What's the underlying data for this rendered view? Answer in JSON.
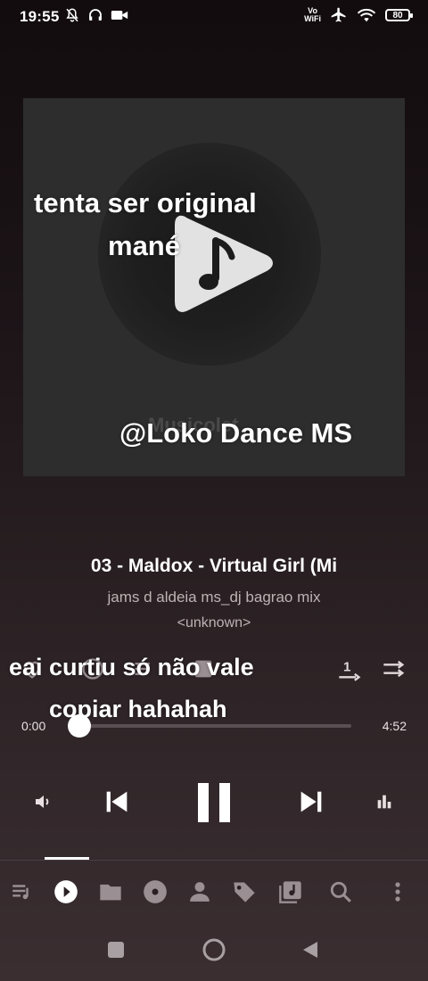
{
  "status_bar": {
    "time": "19:55",
    "volte_line1": "Vo",
    "volte_line2": "WiFi",
    "battery": "80"
  },
  "album": {
    "watermark_text": "Musicolet"
  },
  "overlays": {
    "line1": "tenta ser original",
    "line2": "mané",
    "line3": "@Loko Dance MS",
    "line4": "eai curtiu só não vale",
    "line5": "copiar hahahah"
  },
  "track": {
    "title": "03 - Maldox - Virtual Girl (Mi",
    "artist": "jams d aldeia ms_dj bagrao mix",
    "album": "<unknown>"
  },
  "playback": {
    "current_time": "0:00",
    "total_time": "4:52",
    "progress": 0.0,
    "state": "playing"
  },
  "colors": {
    "accent": "#ffffff",
    "muted_text": "#bdb2b4",
    "album_bg": "#2d2d2d"
  },
  "icons": {
    "actions": [
      "heart-icon",
      "info-icon",
      "queue-add-icon",
      "edit-icon",
      "repeat-one-icon",
      "shuffle-icon"
    ],
    "controls": [
      "volume-icon",
      "previous-icon",
      "pause-icon",
      "next-icon",
      "equalizer-icon"
    ],
    "tabs": [
      "queue-icon",
      "now-playing-icon",
      "folder-icon",
      "album-icon",
      "artist-icon",
      "tag-icon",
      "playlist-icon",
      "search-icon",
      "more-icon"
    ],
    "nav": [
      "recents-icon",
      "home-icon",
      "back-icon"
    ]
  }
}
